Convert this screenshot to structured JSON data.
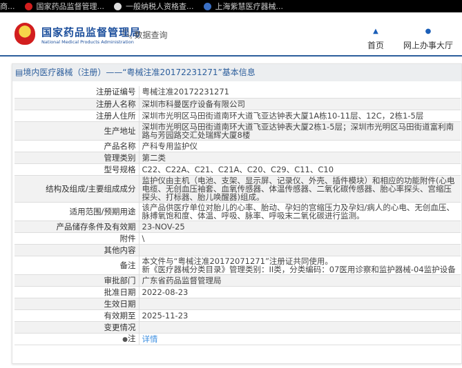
{
  "browser_tabs": [
    "商...",
    "国家药品监督管理...",
    "一般纳税人资格查...",
    "上海紫慧医疗器械..."
  ],
  "header": {
    "logo_cn": "国家药品监督管理局",
    "logo_en": "National Medical Products Administration",
    "data_query": "数据查询",
    "nav": [
      {
        "icon": "home-icon",
        "label": "首页"
      },
      {
        "icon": "user-icon",
        "label": "网上办事大厅"
      }
    ]
  },
  "panel": {
    "title": "境内医疗器械（注册）——“粤械注准20172231271”基本信息"
  },
  "rows": [
    {
      "label": "注册证编号",
      "value": "粤械注准20172231271"
    },
    {
      "label": "注册人名称",
      "value": "深圳市科曼医疗设备有限公司"
    },
    {
      "label": "注册人住所",
      "value": "深圳市光明区马田街道南环大道飞亚达钟表大厦1A栋10-11层、12C，2栋1-5层"
    },
    {
      "label": "生产地址",
      "value": "深圳市光明区马田街道南环大道飞亚达钟表大厦2栋1-5层；深圳市光明区马田街道富利南路与芳园路交汇处瑞辉大厦8楼"
    },
    {
      "label": "产品名称",
      "value": "产科专用监护仪"
    },
    {
      "label": "管理类别",
      "value": "第二类"
    },
    {
      "label": "型号规格",
      "value": "C22、C22A、C21、C21A、C20、C29、C11、C10"
    },
    {
      "label": "结构及组成/主要组成成分",
      "value": "监护仪由主机（电池、支架、显示屏、记录仪、外壳、插件模块）和相应的功能附件(心电电缆、无创血压袖套、血氧传感器、体温传感器、二氧化碳传感器、胎心率探头、宫缩压探头、打标器、胎儿唤醒器)组成。"
    },
    {
      "label": "适用范围/预期用途",
      "value": "该产品供医疗单位对胎儿的心率、胎动、孕妇的宫缩压力及孕妇/病人的心电、无创血压、脉搏氧饱和度、体温、呼吸、脉率、呼吸末二氧化碳进行监测。"
    },
    {
      "label": "产品储存条件及有效期",
      "value": "23-NOV-25"
    },
    {
      "label": "附件",
      "value": "\\"
    },
    {
      "label": "其他内容",
      "value": ""
    },
    {
      "label": "备注",
      "value": "本文件与“粤械注准20172071271”注册证共同使用。",
      "value2": "新《医疗器械分类目录》管理类别：II类，分类编码：07医用诊察和监护器械-04监护设备"
    },
    {
      "label": "审批部门",
      "value": "广东省药品监督管理局"
    },
    {
      "label": "批准日期",
      "value": "2022-08-23"
    },
    {
      "label": "生效日期",
      "value": ""
    },
    {
      "label": "有效期至",
      "value": "2025-11-23"
    },
    {
      "label": "变更情况",
      "value": ""
    },
    {
      "label": "注",
      "value": "详情"
    }
  ]
}
